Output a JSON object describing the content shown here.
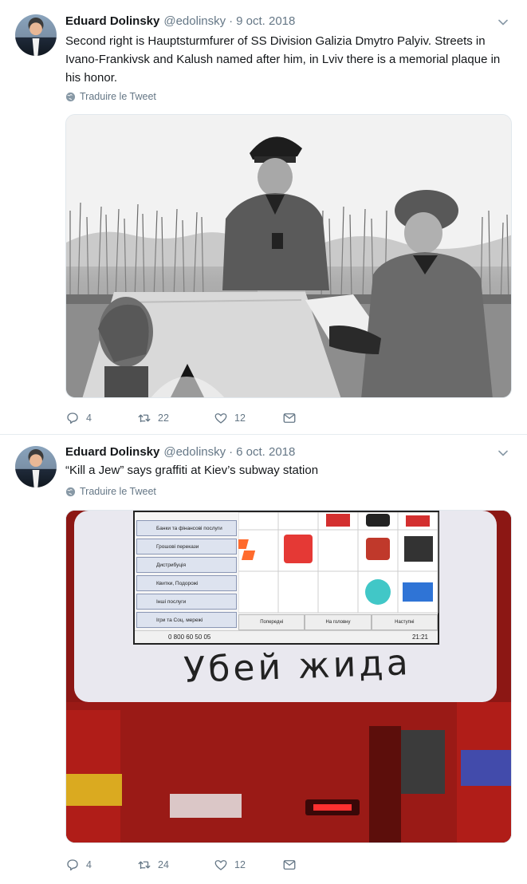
{
  "tweets": [
    {
      "author_name": "Eduard Dolinsky",
      "handle": "@edolinsky",
      "separator": "·",
      "date": "9 oct. 2018",
      "text": "Second right is Hauptsturmfurer of SS Division Galizia Dmytro Palyiv. Streets in Ivano-Frankivsk and Kalush named after him, in Lviv there is a memorial plaque in his honor.",
      "translate_label": "Traduire le Tweet",
      "replies": "4",
      "retweets": "22",
      "likes": "12"
    },
    {
      "author_name": "Eduard Dolinsky",
      "handle": "@edolinsky",
      "separator": "·",
      "date": "6 oct. 2018",
      "text": "“Kill a Jew” says graffiti at Kiev’s subway station",
      "translate_label": "Traduire le Tweet",
      "replies": "4",
      "retweets": "24",
      "likes": "12"
    }
  ],
  "icons": {
    "reply": "reply-icon",
    "retweet": "retweet-icon",
    "like": "heart-icon",
    "dm": "envelope-icon",
    "translate": "globe-icon",
    "caret": "chevron-down-icon"
  },
  "kiosk_photo": {
    "menu_items": [
      "Банки та фінансові послуги",
      "Грошові перекази",
      "Дистрибуція",
      "Квитки, Подорожі",
      "Інші послуги",
      "Ігри та Соц. мережі"
    ],
    "phone": "0 800 60 50 05",
    "time": "21:21",
    "nav_prev": "Попередні",
    "nav_home": "На головну",
    "nav_next": "Наступні",
    "graffiti": "Убей жида"
  },
  "colors": {
    "text": "#14171a",
    "muted": "#657786",
    "border": "#e6ecf0"
  }
}
